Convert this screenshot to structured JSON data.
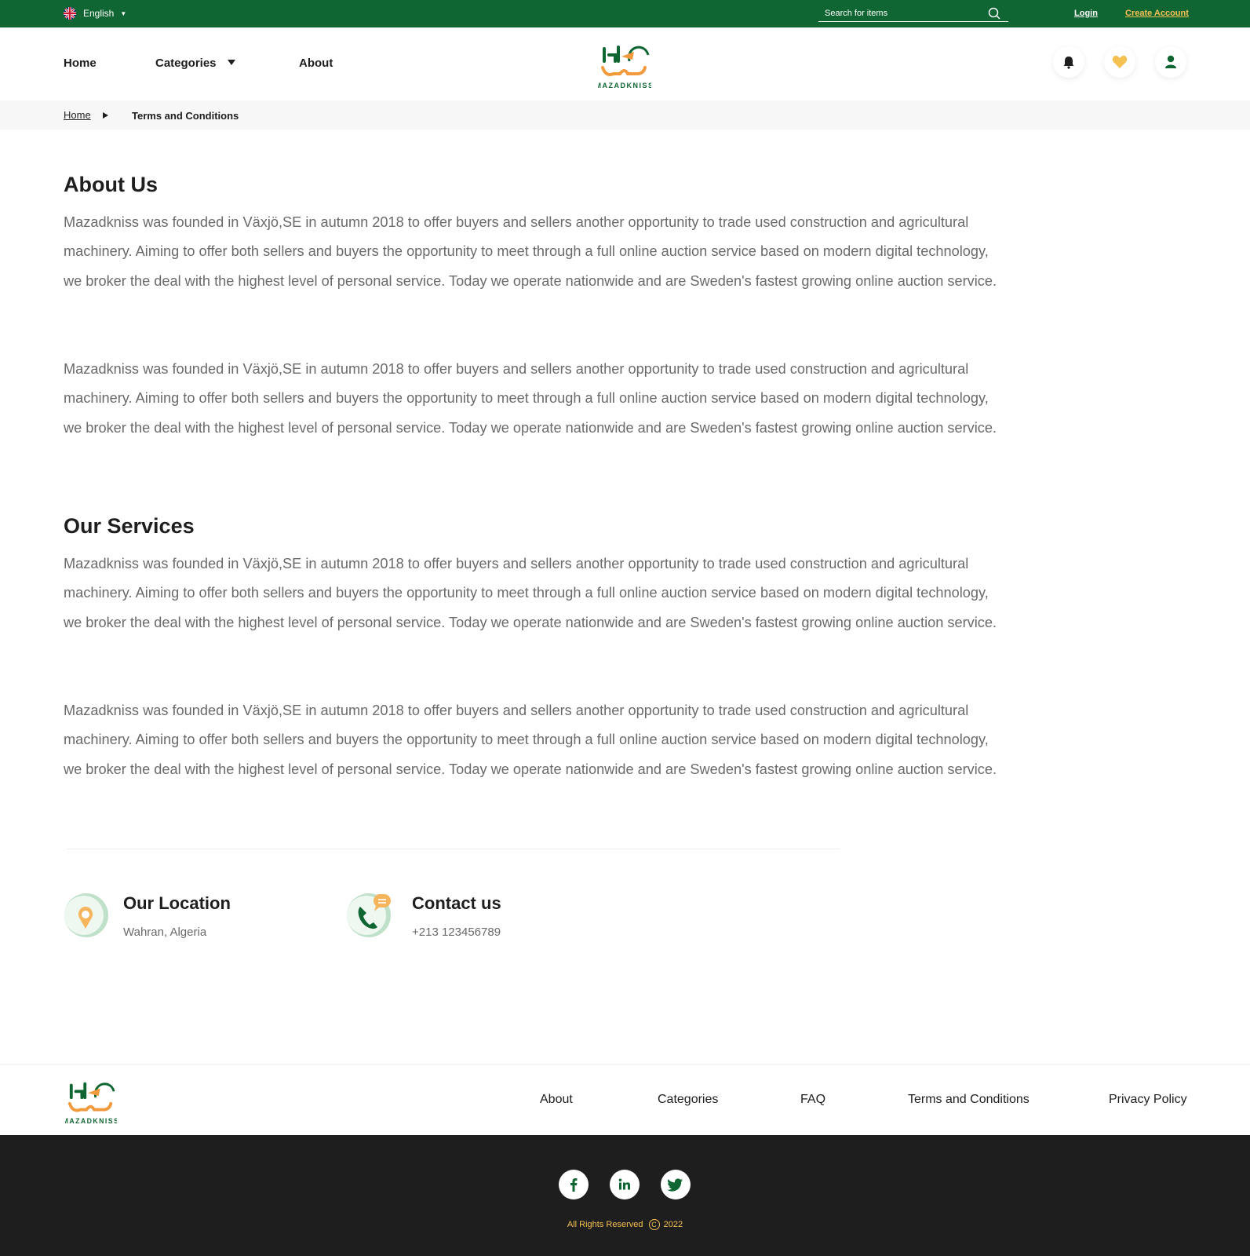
{
  "colors": {
    "brand_green": "#106632",
    "accent_yellow": "#f5c152",
    "dark": "#1e1e1e",
    "text_gray": "#6a6a6a"
  },
  "topbar": {
    "language": "English",
    "search_placeholder": "Search for items",
    "login": "Login",
    "create_account": "Create Account"
  },
  "nav": {
    "home": "Home",
    "categories": "Categories",
    "about": "About",
    "icons": [
      "bell-icon",
      "heart-icon",
      "user-icon"
    ]
  },
  "breadcrumb": {
    "home": "Home",
    "current": "Terms and Conditions"
  },
  "about": {
    "title": "About Us",
    "paragraphs": [
      "Mazadkniss was founded in Växjö,SE in autumn 2018 to offer buyers and sellers another opportunity to trade used construction and agricultural machinery. Aiming to offer both sellers and buyers the opportunity to meet through a full online auction service based on modern digital technology, we broker the deal with the highest level of personal service. Today we operate nationwide and are Sweden's fastest growing online auction service.",
      "Mazadkniss was founded in Växjö,SE in autumn 2018 to offer buyers and sellers another opportunity to trade used construction and agricultural machinery. Aiming to offer both sellers and buyers the opportunity to meet through a full online auction service based on modern digital technology, we broker the deal with the highest level of personal service. Today we operate nationwide and are Sweden's fastest growing online auction service."
    ]
  },
  "services": {
    "title": "Our Services",
    "paragraphs": [
      "Mazadkniss was founded in Växjö,SE in autumn 2018 to offer buyers and sellers another opportunity to trade used construction and agricultural machinery. Aiming to offer both sellers and buyers the opportunity to meet through a full online auction service based on modern digital technology, we broker the deal with the highest level of personal service. Today we operate nationwide and are Sweden's fastest growing online auction service.",
      "Mazadkniss was founded in Växjö,SE in autumn 2018 to offer buyers and sellers another opportunity to trade used construction and agricultural machinery. Aiming to offer both sellers and buyers the opportunity to meet through a full online auction service based on modern digital technology, we broker the deal with the highest level of personal service. Today we operate nationwide and are Sweden's fastest growing online auction service."
    ]
  },
  "location": {
    "title": "Our Location",
    "value": "Wahran, Algeria"
  },
  "contact": {
    "title": "Contact us",
    "value": "+213 123456789"
  },
  "footer": {
    "links": [
      "About",
      "Categories",
      "FAQ",
      "Terms and Conditions",
      "Privacy Policy"
    ],
    "social": [
      "facebook-icon",
      "linkedin-icon",
      "twitter-icon"
    ],
    "rights": "All Rights Reserved",
    "year": "2022"
  }
}
